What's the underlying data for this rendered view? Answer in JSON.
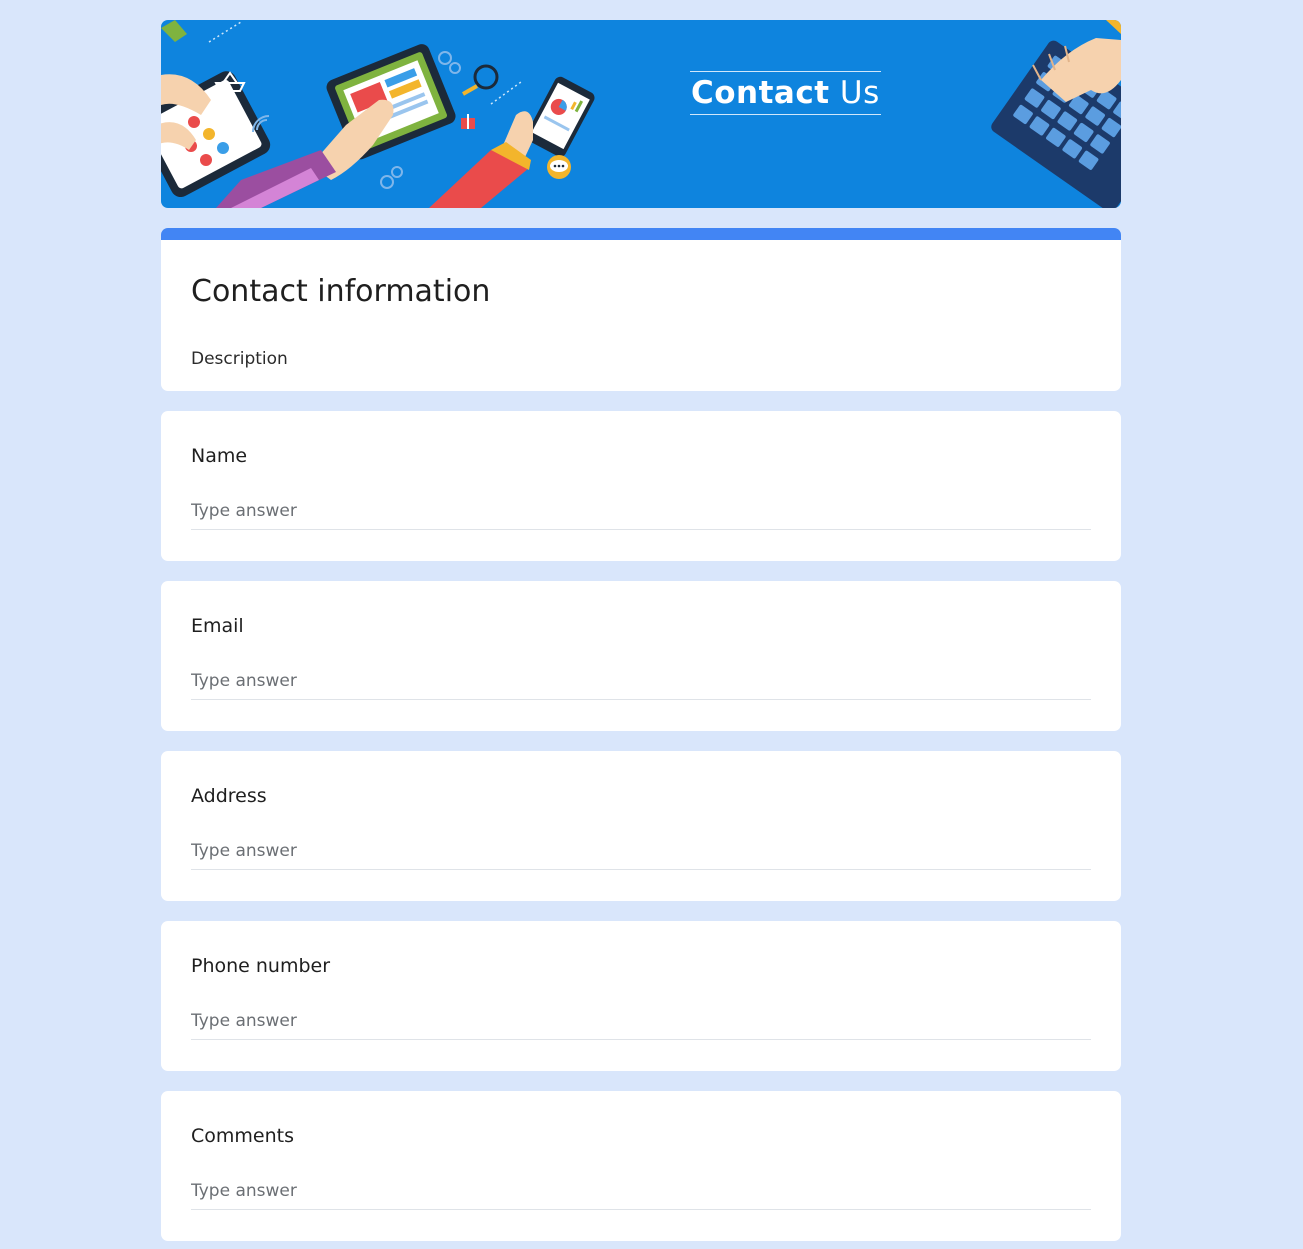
{
  "banner": {
    "title_bold": "Contact",
    "title_light": "Us",
    "colors": {
      "background": "#0e84de",
      "accent": "#4285f4"
    }
  },
  "form": {
    "title": "Contact information",
    "description": "Description"
  },
  "questions": [
    {
      "label": "Name",
      "placeholder": "Type answer"
    },
    {
      "label": "Email",
      "placeholder": "Type answer"
    },
    {
      "label": "Address",
      "placeholder": "Type answer"
    },
    {
      "label": "Phone number",
      "placeholder": "Type answer"
    },
    {
      "label": "Comments",
      "placeholder": "Type answer"
    }
  ]
}
